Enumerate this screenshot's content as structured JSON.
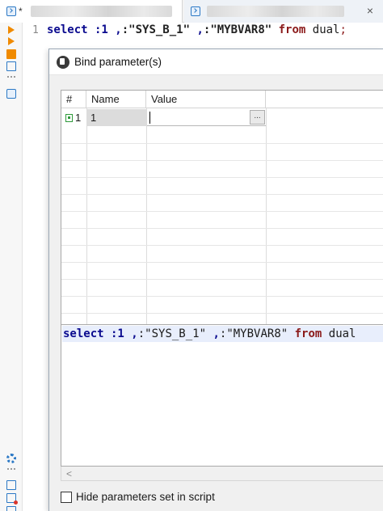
{
  "editor": {
    "tabs": [
      {
        "modified_marker": "*"
      },
      {
        "close_glyph": "×"
      }
    ],
    "line_number": "1",
    "sql": {
      "select": "select",
      "p1": " :1 ,",
      "p2": ":\"SYS_B_1\"",
      "p3": " ,",
      "p4": ":\"MYBVAR8\"",
      "from": " from",
      "dual": " dual",
      "semi": ";"
    }
  },
  "dialog": {
    "title": "Bind parameter(s)",
    "grid": {
      "headers": {
        "index": "#",
        "name": "Name",
        "value": "Value"
      },
      "rows": [
        {
          "index": "1",
          "name": "1",
          "value": "",
          "ellipsis": "..."
        }
      ]
    },
    "preview": {
      "select": "select",
      "p1": " :1 ,",
      "p2": ":\"SYS_B_1\"",
      "p3": " ,",
      "p4": ":\"MYBVAR8\"",
      "from": " from",
      "dual": " dual"
    },
    "scroll_left_glyph": "<",
    "hide_params_label": "Hide parameters set in script",
    "hide_params_checked": false
  },
  "colors": {
    "accent_blue": "#2b78c5",
    "run_orange": "#f08a00",
    "keyword_blue": "#0b0b8f",
    "keyword_red": "#8b1a1a"
  }
}
